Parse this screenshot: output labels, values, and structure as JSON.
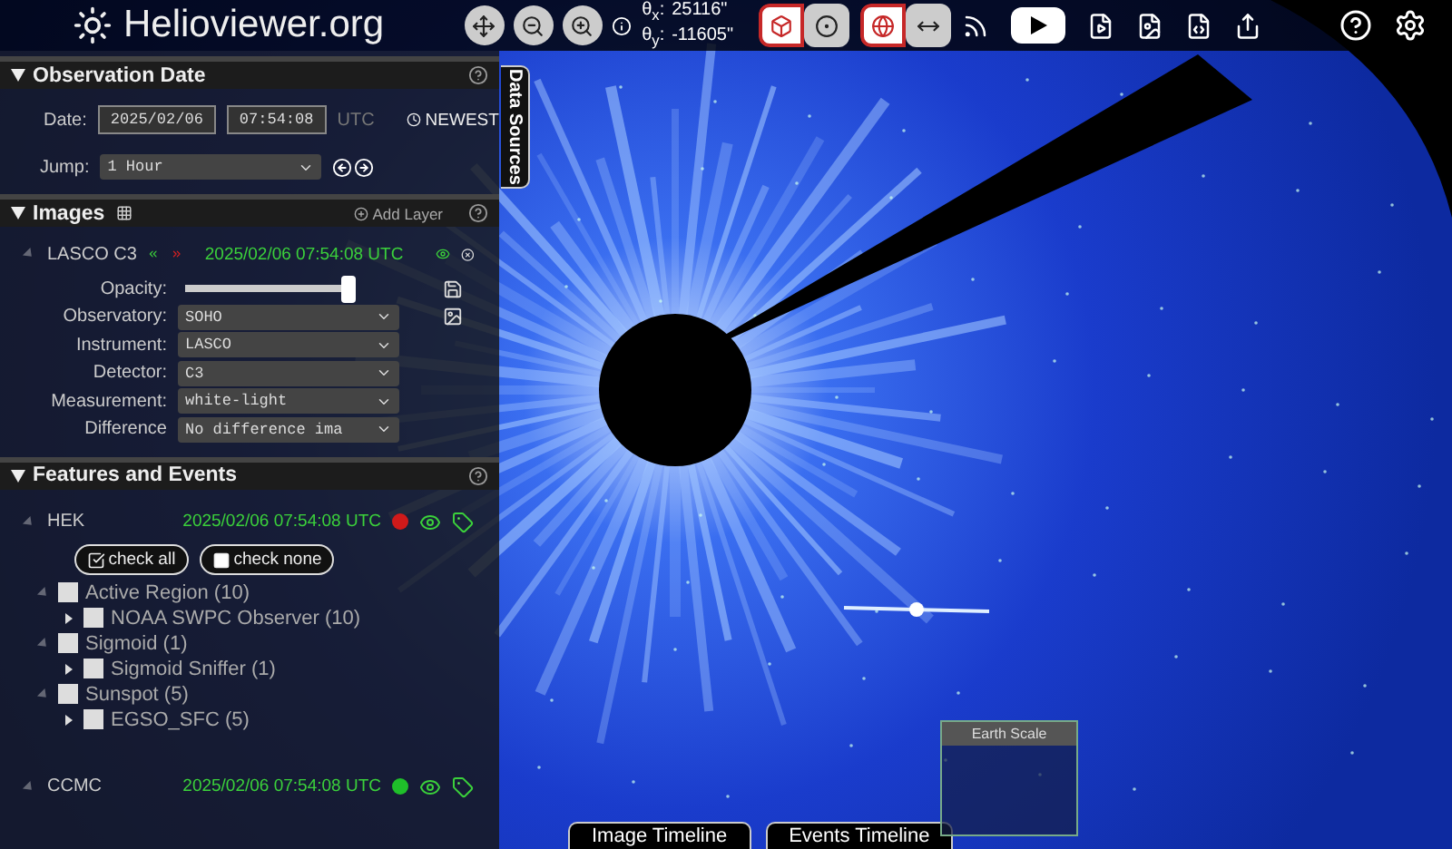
{
  "header": {
    "logo": "Helioviewer.org",
    "coordinates": [
      {
        "label": "θ$_{x}$:",
        "value": "25116\""
      },
      {
        "label": "θ$_{y}$:",
        "value": "-11605\""
      }
    ],
    "view_toggles": [
      {
        "kind": "cube",
        "selected": true
      },
      {
        "kind": "target",
        "selected": false
      }
    ],
    "projection_toggles": [
      {
        "kind": "globe",
        "selected": true
      },
      {
        "kind": "arrows",
        "selected": false
      }
    ]
  },
  "observation_date": {
    "title": "Observation Date",
    "date_label": "Date:",
    "date": "2025/02/06",
    "time": "07:54:08",
    "timezone": "UTC",
    "newest": "NEWEST",
    "jump_label": "Jump:",
    "jump": "1 Hour"
  },
  "images": {
    "title": "Images",
    "add_layer": "Add Layer",
    "layer": {
      "name": "LASCO C3",
      "timestamp": "2025/02/06 07:54:08 UTC",
      "visible": true,
      "opacity_label": "Opacity:",
      "opacity": {
        "level": 0.95
      },
      "fields": [
        {
          "label": "Observatory:",
          "value": "SOHO"
        },
        {
          "label": "Instrument:",
          "value": "LASCO"
        },
        {
          "label": "Detector:",
          "value": "C3"
        },
        {
          "label": "Measurement:",
          "value": "white-light"
        },
        {
          "label": "Difference",
          "value": "No difference ima"
        }
      ]
    }
  },
  "features_and_events": {
    "title": "Features and Events",
    "sources": [
      {
        "name": "HEK",
        "timestamp": "2025/02/06 07:54:08 UTC",
        "color": "#d01a1a",
        "check_all": "check all",
        "check_none": "check none",
        "tree": [
          {
            "label": "Active Region (10)",
            "checked": false,
            "expanded": true,
            "children": [
              {
                "label": "NOAA SWPC Observer (10)",
                "checked": false,
                "expanded": false
              }
            ]
          },
          {
            "label": "Sigmoid (1)",
            "checked": false,
            "expanded": true,
            "children": [
              {
                "label": "Sigmoid Sniffer (1)",
                "checked": false,
                "expanded": false
              }
            ]
          },
          {
            "label": "Sunspot (5)",
            "checked": false,
            "expanded": true,
            "children": [
              {
                "label": "EGSO_SFC (5)",
                "checked": false,
                "expanded": false
              }
            ]
          }
        ]
      },
      {
        "name": "CCMC",
        "timestamp": "2025/02/06 07:54:08 UTC",
        "color": "#1fbf2a"
      }
    ]
  },
  "data_sources_tab": "Data Sources",
  "timeline_tabs": [
    "Image Timeline",
    "Events Timeline"
  ],
  "earth_scale": "Earth Scale"
}
